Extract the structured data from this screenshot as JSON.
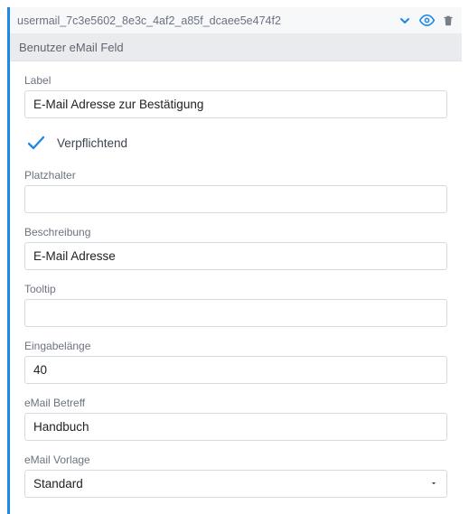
{
  "header": {
    "identifier": "usermail_7c3e5602_8e3c_4af2_a85f_dcaee5e474f2",
    "type_label": "Benutzer eMail Feld"
  },
  "fields": {
    "label": {
      "caption": "Label",
      "value": "E-Mail Adresse zur Bestätigung"
    },
    "required": {
      "caption": "Verpflichtend",
      "checked": true
    },
    "placeholder": {
      "caption": "Platzhalter",
      "value": ""
    },
    "description": {
      "caption": "Beschreibung",
      "value": "E-Mail Adresse"
    },
    "tooltip": {
      "caption": "Tooltip",
      "value": ""
    },
    "inputlength": {
      "caption": "Eingabelänge",
      "value": "40"
    },
    "email_subject": {
      "caption": "eMail Betreff",
      "value": "Handbuch"
    },
    "email_template": {
      "caption": "eMail Vorlage",
      "value": "Standard"
    }
  }
}
